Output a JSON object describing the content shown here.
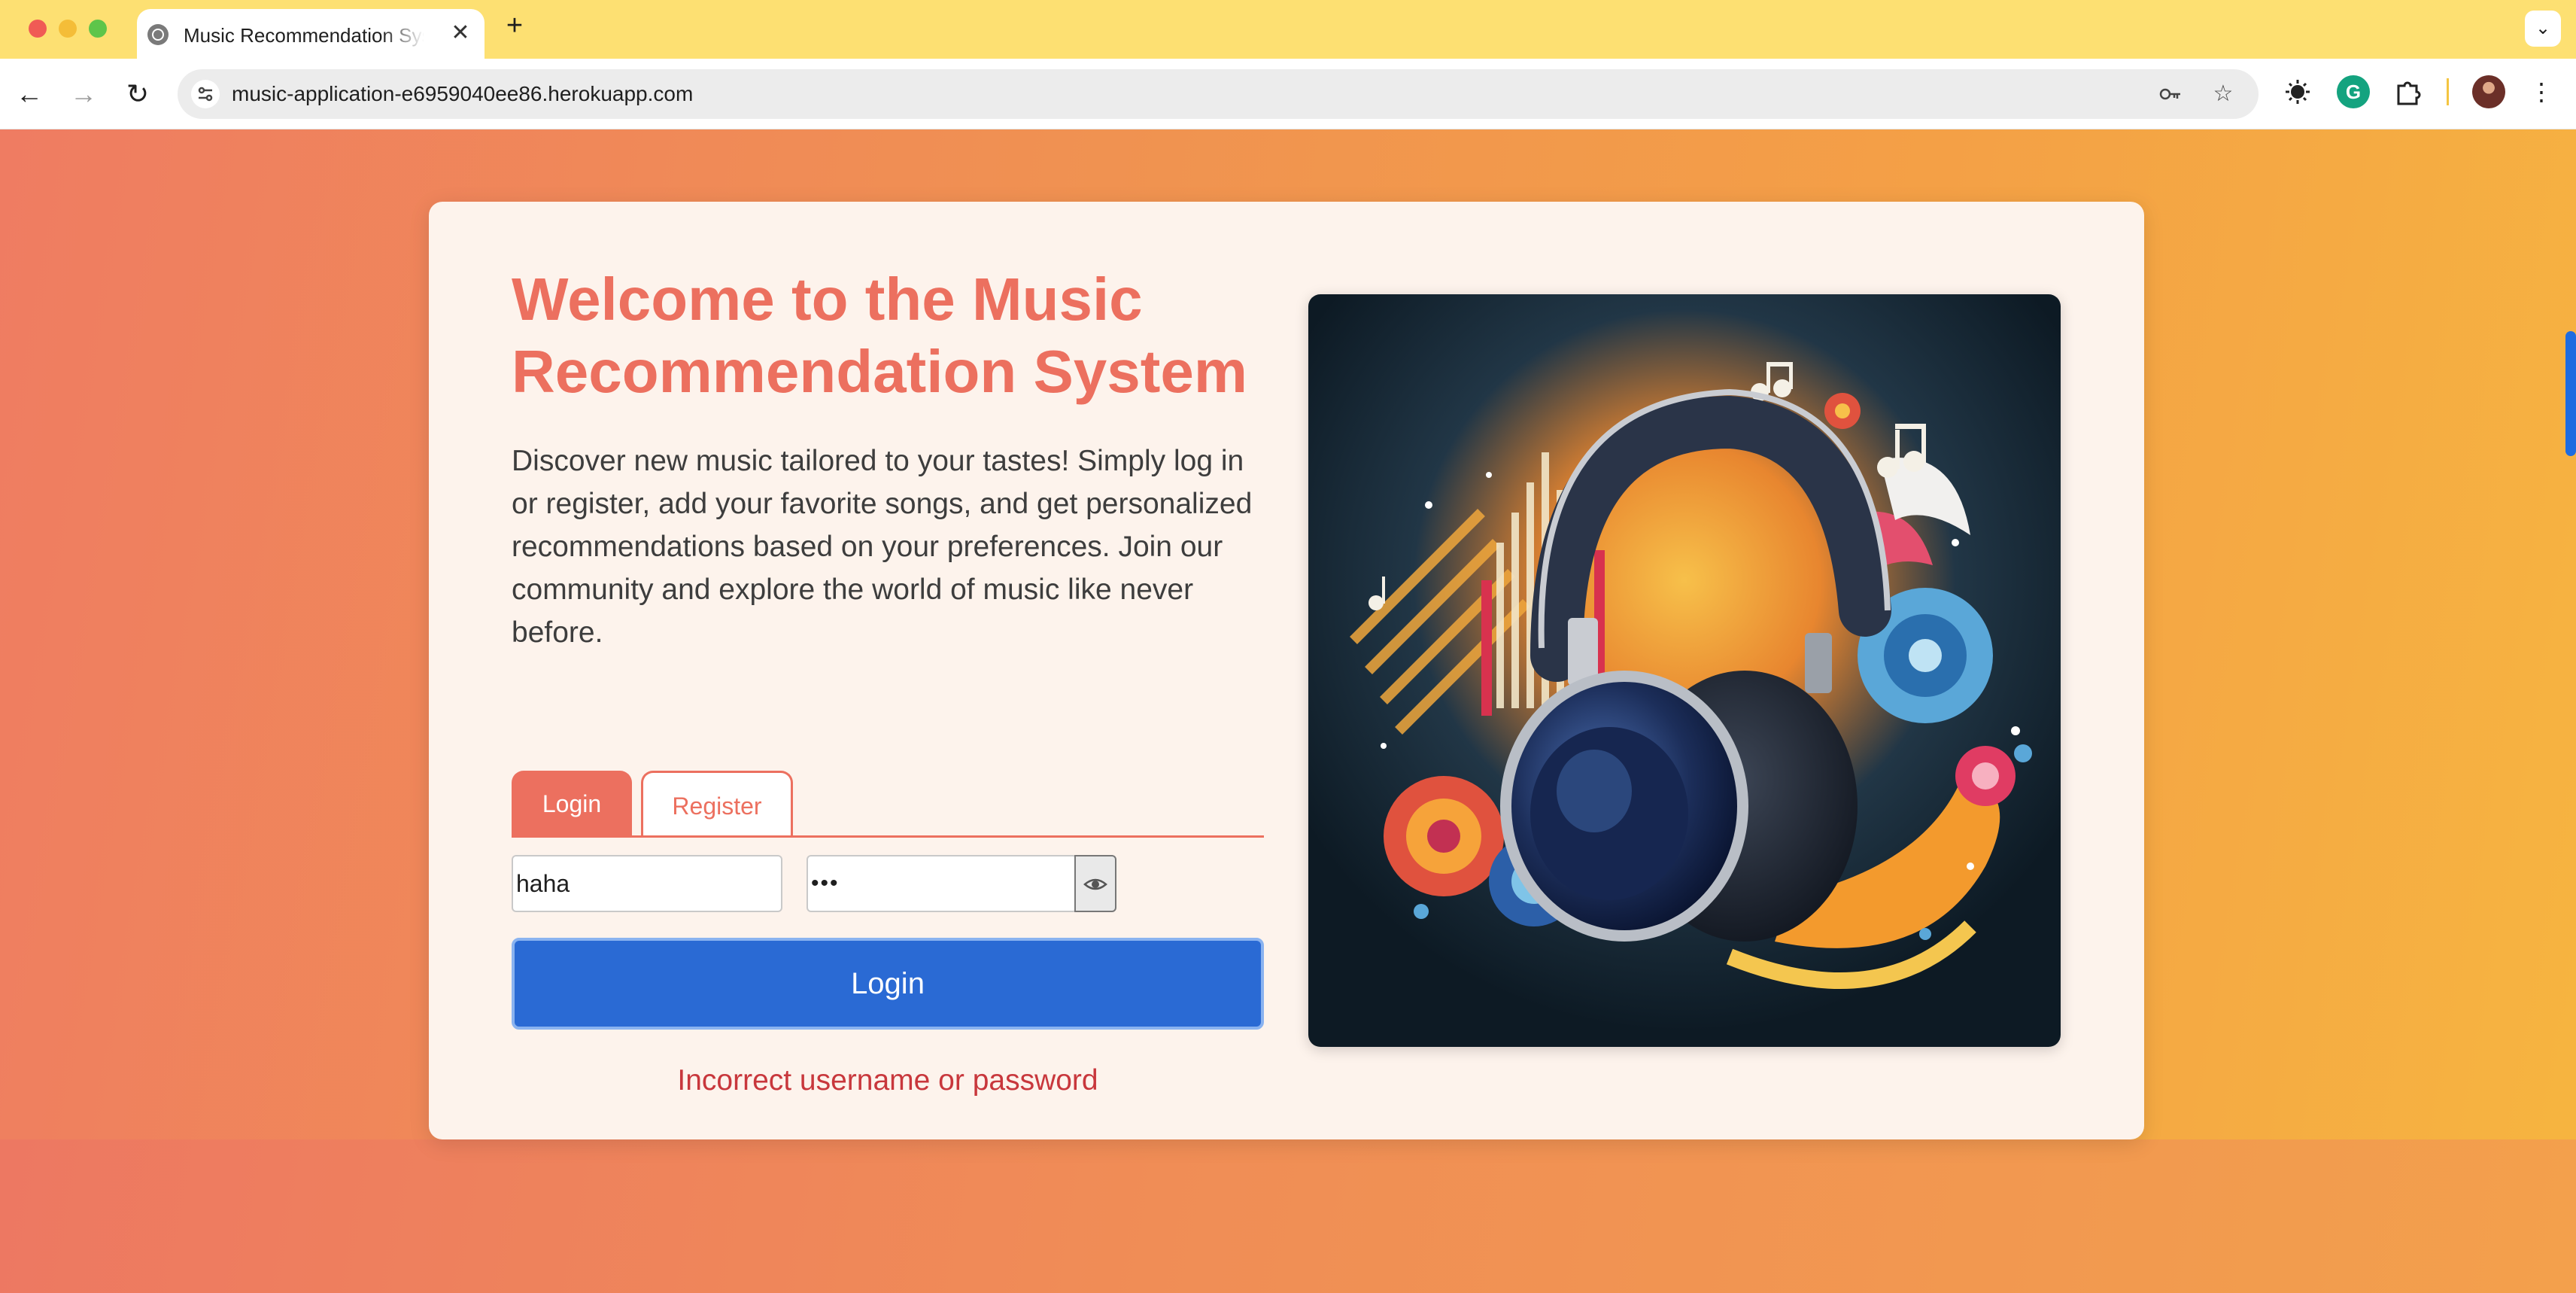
{
  "browser": {
    "tab_title": "Music Recommendation System",
    "tab_close_glyph": "✕",
    "new_tab_glyph": "+",
    "tab_menu_glyph": "⌄",
    "back_glyph": "←",
    "forward_glyph": "→",
    "reload_glyph": "↻",
    "url": "music-application-e6959040ee86.herokuapp.com",
    "icons": [
      "site-info-icon",
      "password-key-icon",
      "bookmark-star-icon",
      "extension-icon",
      "grammarly-icon",
      "puzzle-extensions-icon",
      "profile-avatar",
      "kebab-menu-icon"
    ]
  },
  "page": {
    "title": "Welcome to the Music Recommendation System",
    "description": "Discover new music tailored to your tastes! Simply log in or register, add your favorite songs, and get personalized recommendations based on your preferences. Join our community and explore the world of music like never before.",
    "tabs": [
      {
        "label": "Login",
        "active": true
      },
      {
        "label": "Register",
        "active": false
      }
    ],
    "form": {
      "username_value": "haha",
      "password_value": "•••",
      "show_password_icon": "eye-icon",
      "submit_label": "Login"
    },
    "error_message": "Incorrect username or password",
    "hero_image": "headphones-music-illustration"
  },
  "colors": {
    "accent": "#ec705f",
    "primary_button": "#2a6ad4",
    "error": "#c8373c",
    "card_bg": "#fdf3ec"
  }
}
